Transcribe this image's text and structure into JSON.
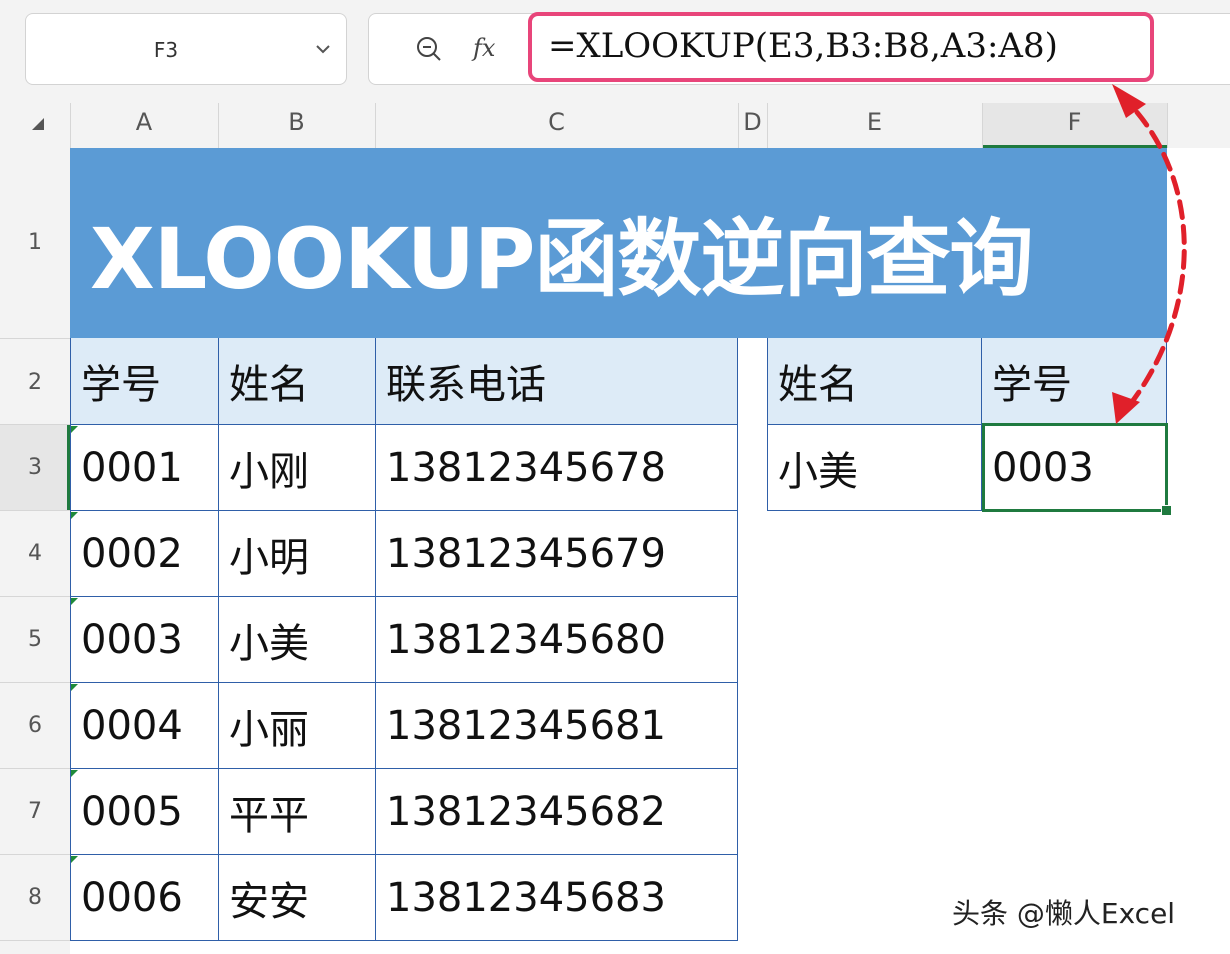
{
  "name_box": {
    "value": "F3"
  },
  "formula_bar": {
    "formula": "=XLOOKUP(E3,B3:B8,A3:A8)"
  },
  "columns": [
    "A",
    "B",
    "C",
    "D",
    "E",
    "F"
  ],
  "rows": [
    "1",
    "2",
    "3",
    "4",
    "5",
    "6",
    "7",
    "8"
  ],
  "title": "XLOOKUP函数逆向查询",
  "table": {
    "headers": [
      "学号",
      "姓名",
      "联系电话"
    ],
    "rows": [
      [
        "0001",
        "小刚",
        "13812345678"
      ],
      [
        "0002",
        "小明",
        "13812345679"
      ],
      [
        "0003",
        "小美",
        "13812345680"
      ],
      [
        "0004",
        "小丽",
        "13812345681"
      ],
      [
        "0005",
        "平平",
        "13812345682"
      ],
      [
        "0006",
        "安安",
        "13812345683"
      ]
    ]
  },
  "lookup": {
    "headers": [
      "姓名",
      "学号"
    ],
    "values": [
      "小美",
      "0003"
    ]
  },
  "watermark": "头条 @懒人Excel",
  "colors": {
    "banner": "#5b9bd5",
    "header_fill": "#ddebf7",
    "grid_border": "#2f5fa8",
    "selection": "#1f7a3f",
    "formula_highlight": "#e8457a",
    "arrow": "#e0202a"
  },
  "icons": [
    "chevron-down-icon",
    "zoom-icon",
    "fx-icon",
    "select-all-icon"
  ]
}
